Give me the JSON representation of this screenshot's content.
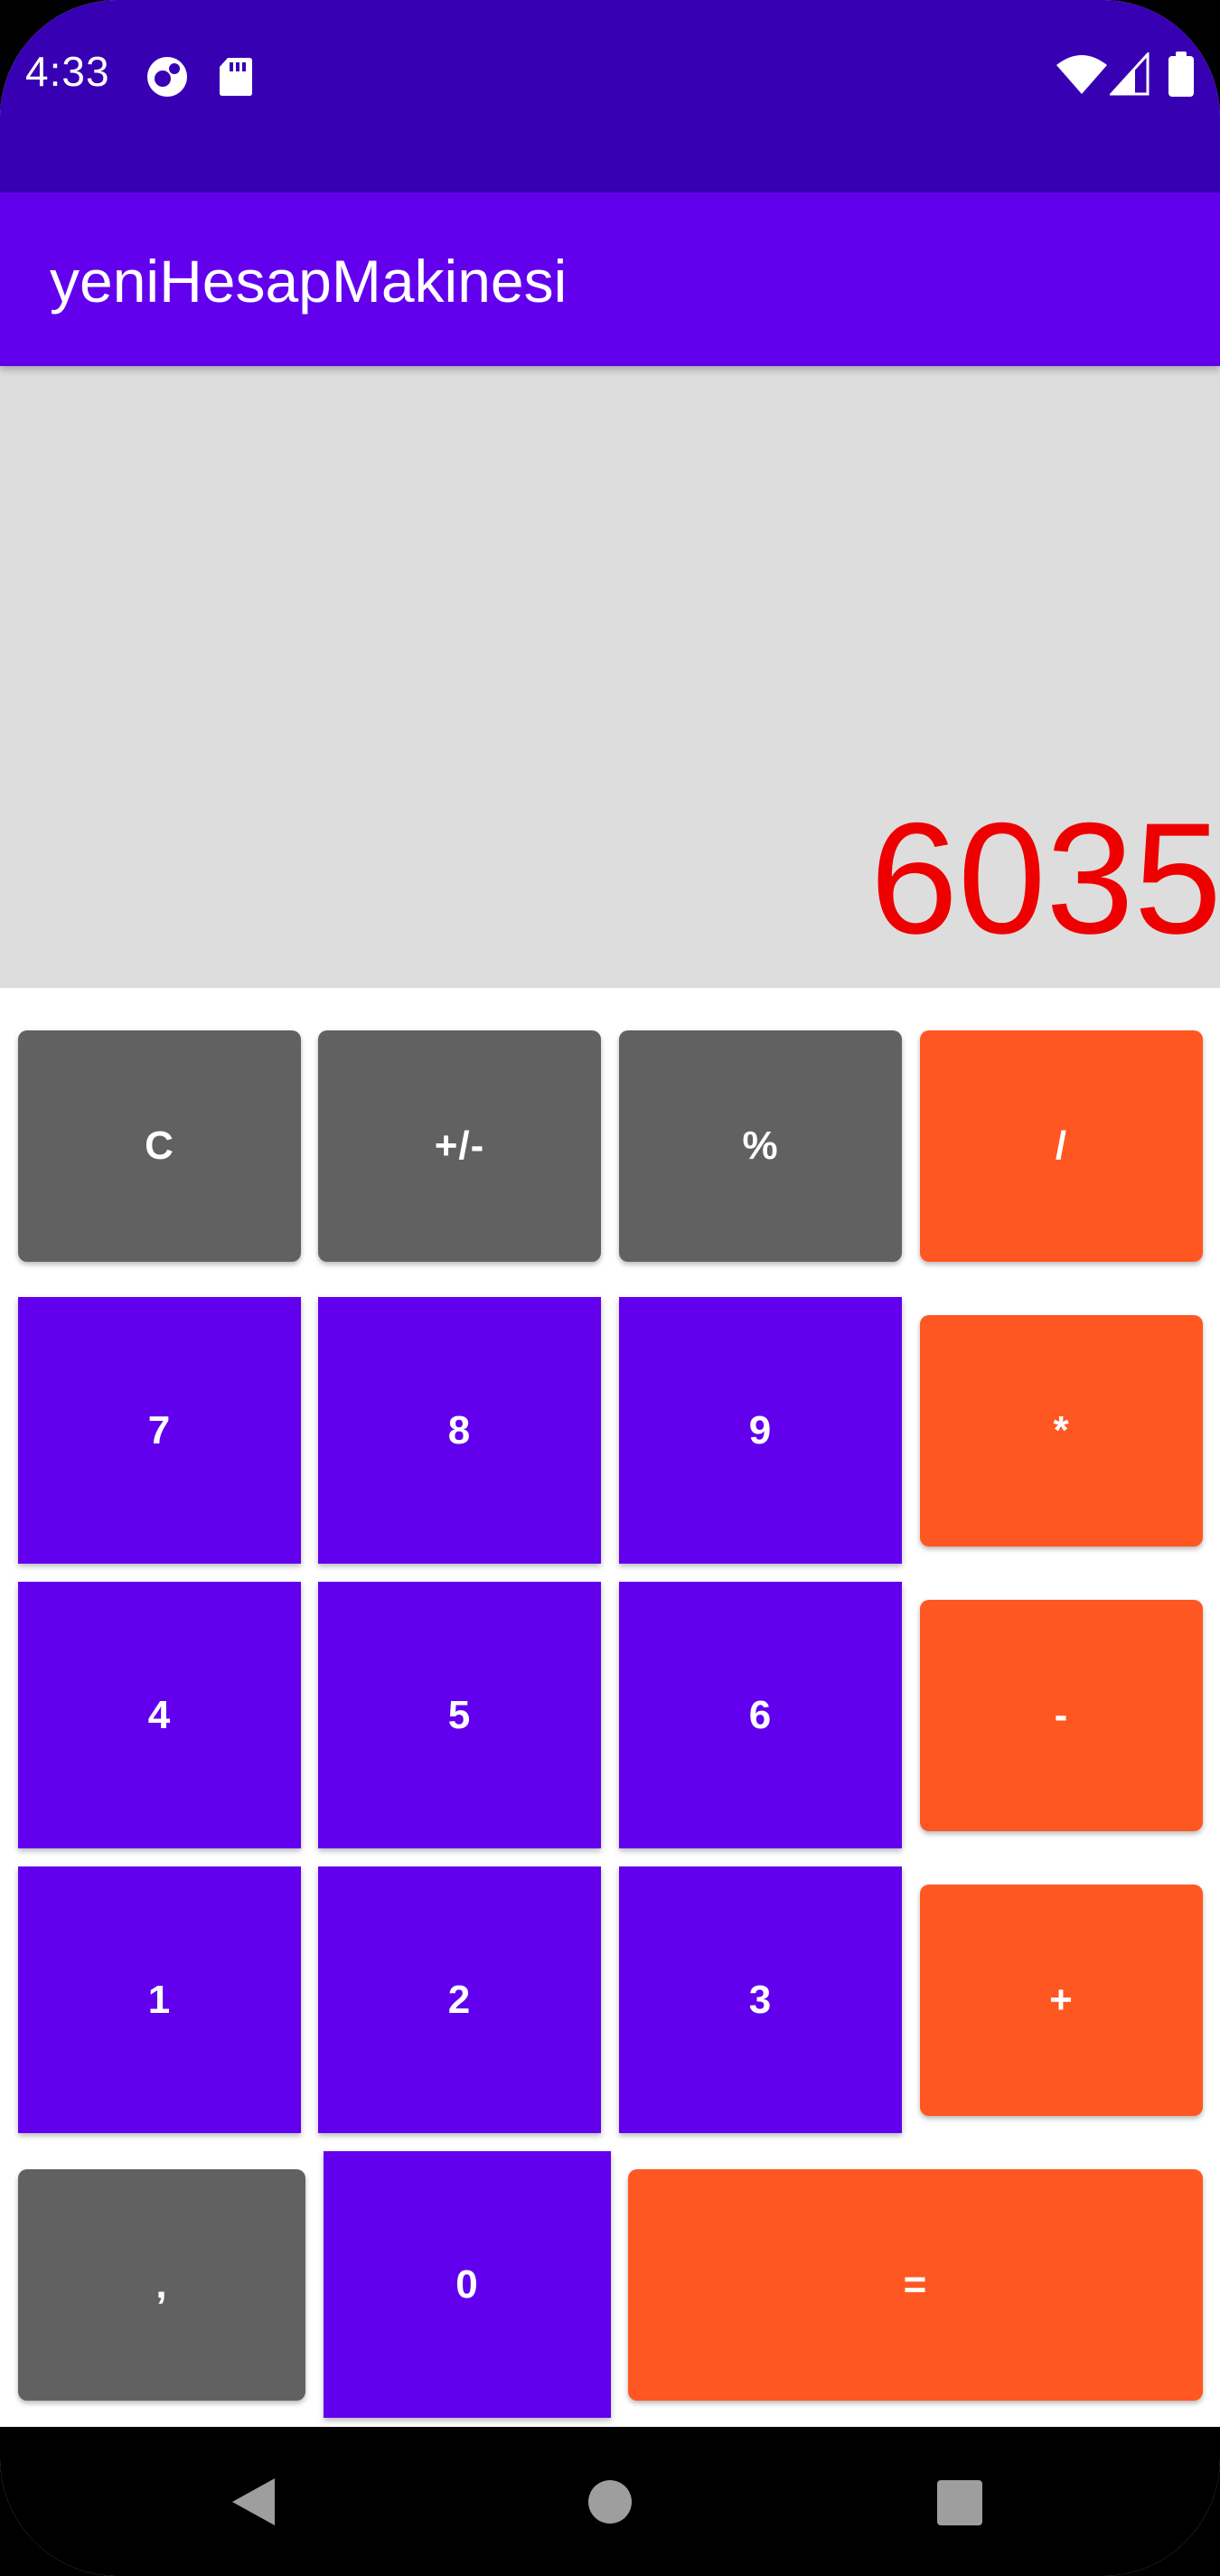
{
  "status_bar": {
    "time": "4:33",
    "icons": [
      "assistant-icon",
      "sd-card-icon",
      "wifi-icon",
      "signal-icon",
      "battery-icon"
    ]
  },
  "app_bar": {
    "title": "yeniHesapMakinesi"
  },
  "display": {
    "value": "6035",
    "color": "#EE0000"
  },
  "keys": {
    "clear": "C",
    "plus_minus": "+/-",
    "percent": "%",
    "divide": "/",
    "seven": "7",
    "eight": "8",
    "nine": "9",
    "multiply": "*",
    "four": "4",
    "five": "5",
    "six": "6",
    "minus": "-",
    "one": "1",
    "two": "2",
    "three": "3",
    "plus": "+",
    "comma": ",",
    "zero": "0",
    "equals": "="
  },
  "colors": {
    "status_bar": "#3700B3",
    "app_bar": "#6200EE",
    "display_bg": "#DDDDDD",
    "digit_key": "#6200EE",
    "function_key": "#616161",
    "operator_key": "#FF5722"
  },
  "nav_bar": {
    "icons": [
      "back-icon",
      "home-icon",
      "recents-icon"
    ]
  }
}
